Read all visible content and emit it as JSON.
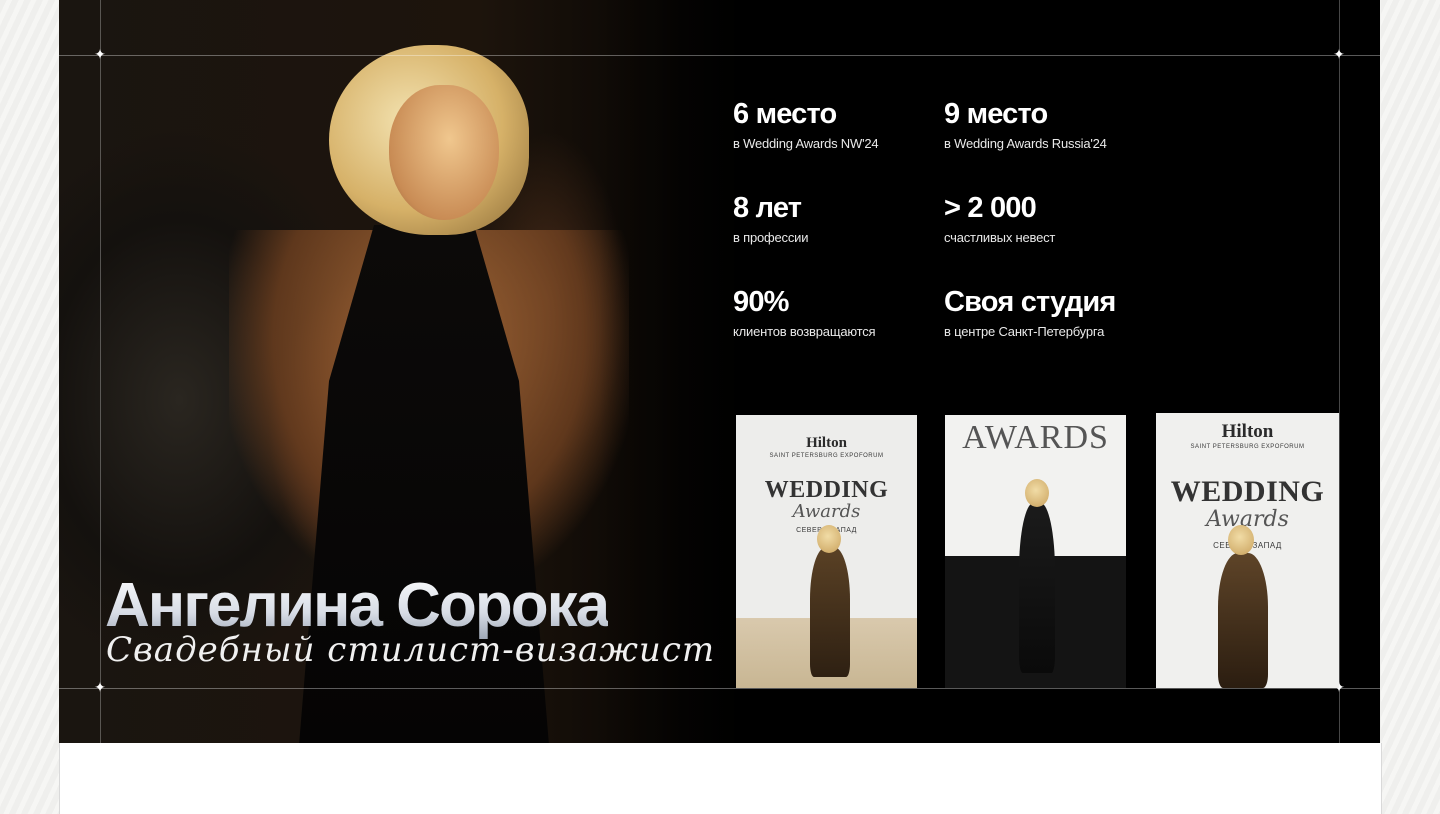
{
  "hero": {
    "name": "Ангелина Сорока",
    "subtitle": "Свадебный стилист-визажист"
  },
  "stats": [
    {
      "value": "6 место",
      "caption": "в Wedding Awards NW'24"
    },
    {
      "value": "9 место",
      "caption": "в Wedding Awards Russia'24"
    },
    {
      "value": "8 лет",
      "caption": "в профессии"
    },
    {
      "value": "> 2 000",
      "caption": "счастливых невест"
    },
    {
      "value": "90%",
      "caption": "клиентов возвращаются"
    },
    {
      "value": "Своя студия",
      "caption": "в центре Санкт-Петербурга"
    }
  ],
  "gallery": [
    {
      "brand": "Hilton",
      "brand_sub": "SAINT PETERSBURG EXPOFORUM",
      "headline": "WEDDING",
      "script": "Awards",
      "side_text": "СЕВЕРО-ЗАПАД"
    },
    {
      "headline": "AWARDS"
    },
    {
      "brand": "Hilton",
      "brand_sub": "SAINT PETERSBURG EXPOFORUM",
      "headline": "WEDDING",
      "script": "Awards",
      "side_text": "СЕВЕРО-ЗАПАД"
    }
  ],
  "decor": {
    "star_glyph": "✦"
  },
  "colors": {
    "background": "#000000",
    "text": "#ffffff",
    "page": "#f3f3f1"
  }
}
